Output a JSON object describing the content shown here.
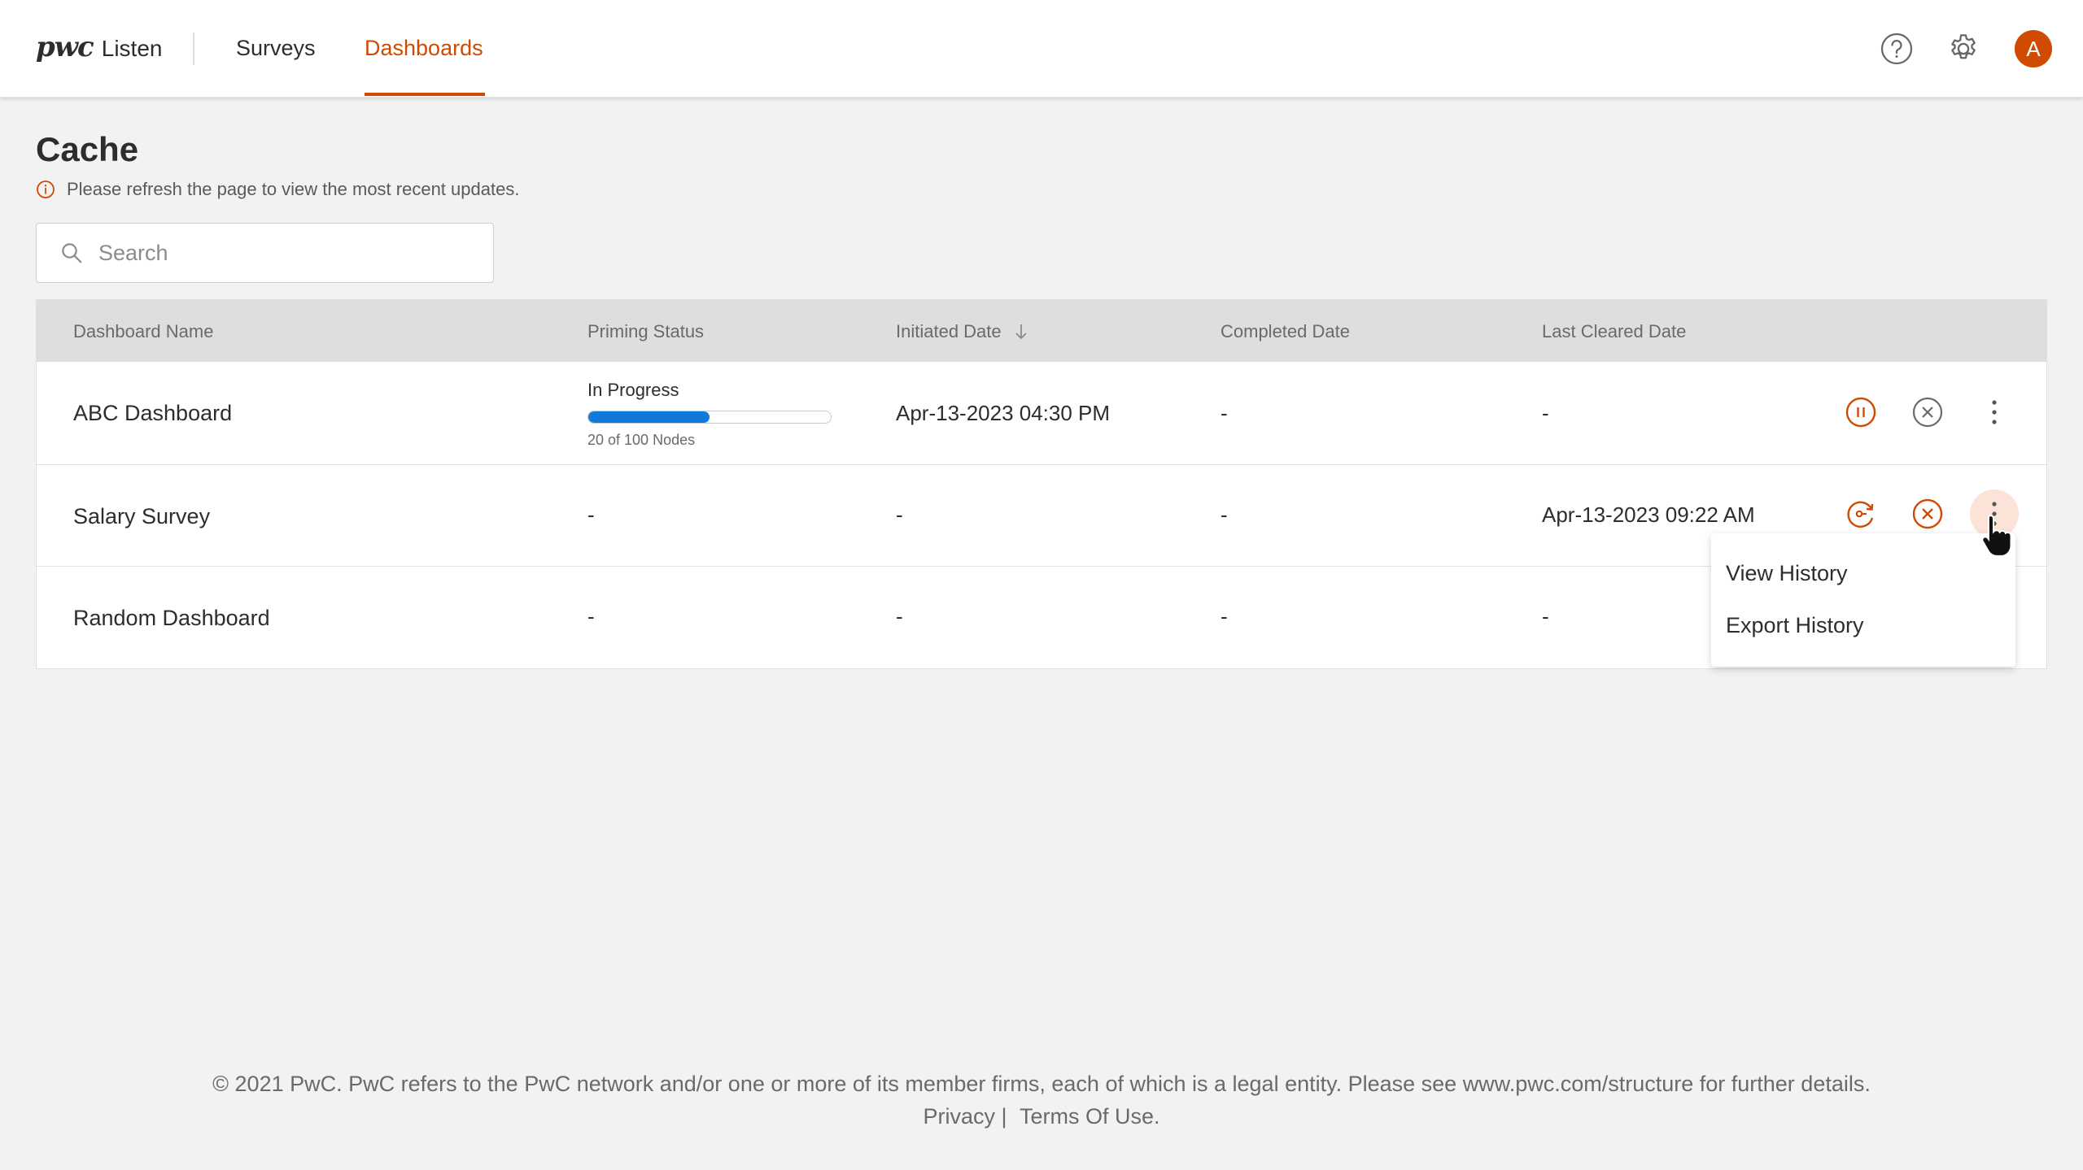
{
  "header": {
    "brand_logo": "pwc",
    "brand_product": "Listen",
    "nav": [
      {
        "label": "Surveys",
        "active": false
      },
      {
        "label": "Dashboards",
        "active": true
      }
    ],
    "icons": [
      "help-icon",
      "settings-icon"
    ],
    "avatar_initial": "A",
    "accent_color": "#d04a02"
  },
  "page": {
    "title": "Cache",
    "notice": "Please refresh the page to view the most recent updates.",
    "search_placeholder": "Search"
  },
  "table": {
    "columns": [
      "Dashboard Name",
      "Priming Status",
      "Initiated Date",
      "Completed Date",
      "Last Cleared Date"
    ],
    "sorted_column": "Initiated Date",
    "sort_direction": "descending",
    "rows": [
      {
        "name": "ABC Dashboard",
        "status_label": "In Progress",
        "progress_fraction": 0.2,
        "progress_text": "20 of 100 Nodes",
        "initiated": "Apr-13-2023  04:30 PM",
        "completed": "-",
        "last_cleared": "-",
        "actions": [
          "pause-icon",
          "cancel-icon",
          "more-icon"
        ]
      },
      {
        "name": "Salary Survey",
        "status": "-",
        "initiated": "-",
        "completed": "-",
        "last_cleared": "Apr-13-2023  09:22 AM",
        "actions": [
          "prime-icon",
          "cancel-icon",
          "more-icon"
        ]
      },
      {
        "name": "Random Dashboard",
        "status": "-",
        "initiated": "-",
        "completed": "-",
        "last_cleared": "-"
      }
    ]
  },
  "menu": {
    "items": [
      "View History",
      "Export History"
    ]
  },
  "footer": {
    "copyright": "© 2021 PwC. PwC refers to the PwC network and/or one or more of its member firms, each of which is a legal entity. Please see www.pwc.com/structure for further details.",
    "privacy": "Privacy |",
    "terms": "Terms Of Use."
  }
}
